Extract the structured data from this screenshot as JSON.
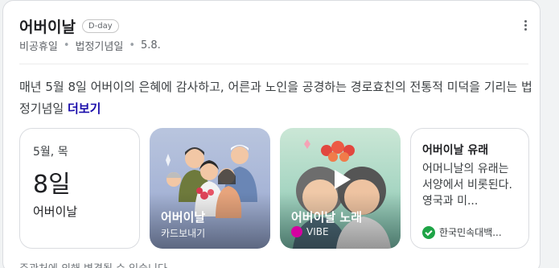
{
  "header": {
    "title": "어버이날",
    "badge": "D-day",
    "meta": [
      "비공휴일",
      "법정기념일",
      "5.8."
    ]
  },
  "description": {
    "text": "매년 5월 8일 어버이의 은혜에 감사하고, 어른과 노인을 공경하는 경로효친의 전통적 미덕을 기리는 법정기념일",
    "more_link": "더보기"
  },
  "cards": {
    "date_card": {
      "line1": "5월, 목",
      "day": "8일",
      "name": "어버이날"
    },
    "ecard": {
      "title": "어버이날",
      "subtitle": "카드보내기"
    },
    "song": {
      "title": "어버이날 노래",
      "source": "VIBE"
    },
    "origin": {
      "title": "어버이날 유래",
      "body": "어머니날의 유래는 서양에서 비롯된다. 영국과 미...",
      "source": "한국민속대백..."
    }
  },
  "footer": {
    "text": "주관처에 의해 변경될 수 있습니다."
  },
  "colors": {
    "link": "#1a0dab",
    "vibe": "#d500a0",
    "source_green": "#1ea446"
  }
}
